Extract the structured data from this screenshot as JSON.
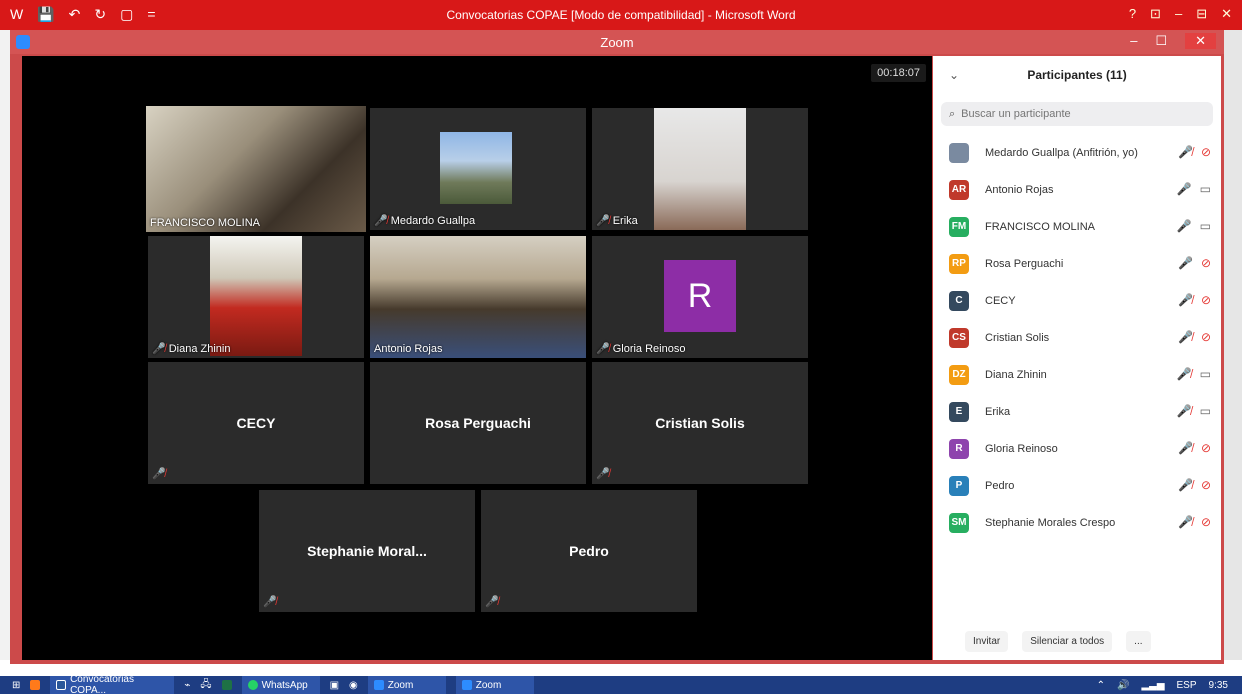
{
  "word": {
    "title": "Convocatorias COPAE [Modo de compatibilidad] - Microsoft Word",
    "icons": [
      "W",
      "💾",
      "↶",
      "↻",
      "▢",
      "="
    ],
    "controls": [
      "?",
      "⊡",
      "–",
      "⊟",
      "✕"
    ]
  },
  "zoom": {
    "title": "Zoom",
    "controls": [
      "–",
      "☐",
      "✕"
    ]
  },
  "gallery": {
    "timer": "00:18:07",
    "tiles": [
      {
        "name": "FRANCISCO MOLINA",
        "muted": false,
        "kind": "video"
      },
      {
        "name": "Medardo Guallpa",
        "muted": true,
        "kind": "picture"
      },
      {
        "name": "Erika",
        "muted": true,
        "kind": "video"
      },
      {
        "name": "Diana Zhinin",
        "muted": true,
        "kind": "video"
      },
      {
        "name": "Antonio Rojas",
        "muted": false,
        "kind": "video"
      },
      {
        "name": "Gloria Reinoso",
        "muted": true,
        "kind": "avatar",
        "avatar_letter": "R"
      },
      {
        "name": "CECY",
        "muted": true,
        "kind": "name"
      },
      {
        "name": "Rosa Perguachi",
        "muted": false,
        "kind": "name"
      },
      {
        "name": "Cristian Solis",
        "muted": true,
        "kind": "name"
      },
      {
        "name": "Stephanie  Moral...",
        "muted": true,
        "kind": "name"
      },
      {
        "name": "Pedro",
        "muted": true,
        "kind": "name"
      }
    ]
  },
  "panel": {
    "title": "Participantes (11)",
    "search_placeholder": "Buscar un participante",
    "participants": [
      {
        "initials": "",
        "name": "Medardo Guallpa (Anfitrión, yo)",
        "color": "#7a8aa0",
        "mic": "muted",
        "cam": "off"
      },
      {
        "initials": "AR",
        "name": "Antonio Rojas",
        "color": "#c0392b",
        "mic": "on",
        "cam": "on"
      },
      {
        "initials": "FM",
        "name": "FRANCISCO MOLINA",
        "color": "#27ae60",
        "mic": "speaking",
        "cam": "on"
      },
      {
        "initials": "RP",
        "name": "Rosa Perguachi",
        "color": "#f39c12",
        "mic": "on",
        "cam": "off"
      },
      {
        "initials": "C",
        "name": "CECY",
        "color": "#34495e",
        "mic": "muted",
        "cam": "off"
      },
      {
        "initials": "CS",
        "name": "Cristian Solis",
        "color": "#c0392b",
        "mic": "muted",
        "cam": "off"
      },
      {
        "initials": "DZ",
        "name": "Diana Zhinin",
        "color": "#f39c12",
        "mic": "muted",
        "cam": "on"
      },
      {
        "initials": "E",
        "name": "Erika",
        "color": "#34495e",
        "mic": "muted",
        "cam": "on"
      },
      {
        "initials": "R",
        "name": "Gloria Reinoso",
        "color": "#8e44ad",
        "mic": "muted",
        "cam": "off"
      },
      {
        "initials": "P",
        "name": "Pedro",
        "color": "#2980b9",
        "mic": "muted",
        "cam": "off"
      },
      {
        "initials": "SM",
        "name": "Stephanie Morales Crespo",
        "color": "#27ae60",
        "mic": "muted",
        "cam": "off"
      }
    ],
    "buttons": {
      "invite": "Invitar",
      "mute_all": "Silenciar a todos",
      "more": "..."
    }
  },
  "taskbar": {
    "word_item": "Convocatorias COPA...",
    "whatsapp": "WhatsApp",
    "zoom1": "Zoom",
    "zoom2": "Zoom",
    "lang": "ESP",
    "time": "9:35"
  }
}
